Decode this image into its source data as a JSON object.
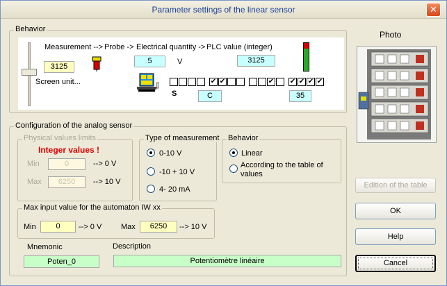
{
  "window": {
    "title": "Parameter settings of the linear sensor",
    "close_label": "✕"
  },
  "behavior_panel": {
    "legend": "Behavior",
    "chain": {
      "measurement": "Measurement -->",
      "probe": "Probe ->",
      "electrical": "Electrical quantity ->",
      "plc": "PLC value (integer)"
    },
    "screen_value": "3125",
    "screen_unit": "Screen unit...",
    "electrical_value": "5",
    "electrical_unit": "V",
    "plc_value": "3125",
    "bits": [
      [
        false,
        false,
        false,
        false
      ],
      [
        true,
        true,
        false,
        false
      ],
      [
        false,
        false,
        true,
        false
      ],
      [
        true,
        true,
        true,
        true
      ]
    ],
    "s_label": "S",
    "c_value": "C",
    "bits_value": "35"
  },
  "photo": {
    "label": "Photo"
  },
  "config": {
    "legend": "Configuration of the analog sensor",
    "physical": {
      "legend": "Physical values limits",
      "integer_label": "Integer values !",
      "min_label": "Min",
      "min_value": "0",
      "min_arrow": "--> 0 V",
      "max_label": "Max",
      "max_value": "6250",
      "max_arrow": "--> 10 V"
    },
    "measurement": {
      "legend": "Type of measurement",
      "options": [
        "0-10 V",
        "-10 + 10 V",
        "4- 20 mA"
      ],
      "selected": 0
    },
    "behavior": {
      "legend": "Behavior",
      "options": [
        "Linear",
        "According to the table of values"
      ],
      "selected": 0
    },
    "automaton": {
      "legend": "Max input value for the automaton  IW xx",
      "min_label": "Min",
      "min_value": "0",
      "min_arrow": "--> 0 V",
      "max_label": "Max",
      "max_value": "6250",
      "max_arrow": "--> 10 V"
    },
    "mnemonic": {
      "label": "Mnemonic",
      "value": "Poten_0"
    },
    "description": {
      "label": "Description",
      "value": "Potentiomètre linéaire"
    }
  },
  "buttons": {
    "edition": "Edition of the table",
    "ok": "OK",
    "help": "Help",
    "cancel": "Cancel"
  }
}
